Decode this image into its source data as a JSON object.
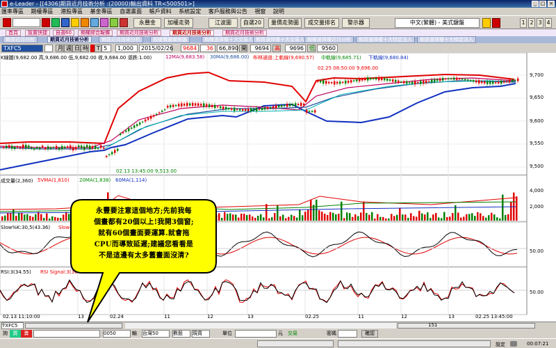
{
  "window": {
    "title": "e-Leader - [[4306]期貨近月技術分析 :(20000)輸出資料  TR<500501>]",
    "controls": [
      "_",
      "□",
      "×"
    ]
  },
  "menu": [
    "匯率專區",
    "期權專區",
    "港股專區",
    "基金專區",
    "自選畫面",
    "帳戶資料",
    "系統設定",
    "客戶服務與公告",
    "視窗",
    "說明"
  ],
  "toolbar": {
    "buttons": [
      "永豐金",
      "加權走勢",
      "江波圖",
      "自選20",
      "量價走勢圖",
      "成交量排名",
      "警示器"
    ],
    "language": "中文(繁體) - 美式鍵盤",
    "page_numbers": [
      "1",
      "2",
      "3",
      "4"
    ]
  },
  "tabs_top": [
    "首頁",
    "設置快捷",
    "自選60",
    "期權綜合報價",
    "期貨近月技術分析",
    "期貨近月技術分析",
    "期貨近月技術分析"
  ],
  "tabs_second": [
    "期貨近月分析",
    "期貨近月技術分析",
    "期貨近月技術分析",
    "期權價量關係圖",
    "期權選擇權十大交易人",
    "期貨選擇權十大交易人",
    "期權選擇權近月分析",
    "期貨選擇權十大特定法人",
    "期貨選擇權十大特定法人"
  ],
  "controls": {
    "symbol": "TXFC5",
    "period_label": "月",
    "period_buttons": [
      "週",
      "日",
      "時"
    ],
    "t_label": "T",
    "t_value": "5",
    "count": "1,000",
    "date": "2015/02/26",
    "quote_last": "9684",
    "quote_change": "36",
    "quote_volume": "66,890",
    "open_label": "開",
    "open_value": "9694",
    "high_label": "高",
    "high_value": "9696",
    "low_label": "低",
    "low_value": "9560"
  },
  "panels": {
    "kline": {
      "header": "K線圖(9,682.00 高,9,686.00 低,9,682.00 收,9,684.00 漲跌:1.00)",
      "ma12": "12MA(9,683.58)",
      "ma30": "30MA(9,686.00)",
      "bband": "布林通道:上軌線(9,690.57)",
      "mid_band": "中軌線(9,685.71)",
      "low_band": "下軌線(9,680.84)",
      "annotation_high": "02.25 08:50:00  9,696.00",
      "annotation_low": "02.13 13:45:00  9,513.00",
      "y_ticks": [
        "9,700",
        "9,650",
        "9,600",
        "9,550",
        "9,500"
      ]
    },
    "volume": {
      "header": "成交量(2,360)",
      "ma5": "5VMA(1,810)",
      "ma20": "20MA(1,838)",
      "ma60": "60MA(1,114)",
      "y_ticks": [
        "4,000",
        "2,000"
      ]
    },
    "kd": {
      "header": "Slow%K:30,5(43.36)",
      "d_label": "Slow",
      "y_ticks": [
        "50.00"
      ]
    },
    "rsi": {
      "header": "RSI:3(34.55)",
      "signal": "RSI Signal:3(36",
      "y_ticks": [
        "50.00"
      ]
    }
  },
  "time_axis": {
    "labels": [
      "02.13 11:10:00",
      "13",
      "02.24",
      "11",
      "12",
      "13",
      "02.25",
      "11",
      "12",
      "13",
      "02.25 13:45:00"
    ]
  },
  "status": {
    "symbol_tab": "TXFC5",
    "scroll_value": "151"
  },
  "order_bar": {
    "buy_label": "買",
    "sell_label": "賣",
    "code": "0050",
    "exchange_label": "輸",
    "market": "台灣50",
    "quantity_label": "數股",
    "price_type": "現貨",
    "unit_label": "單位",
    "price_unit": "元",
    "order_type": "交易",
    "password_label": "密碼",
    "confirm_label": "確認",
    "settings_label": "設定",
    "clock": "00:07:21"
  },
  "callout": {
    "lines": [
      "永豐要注意這個地方;先前我每",
      "個畫都有20個以上!我開3個窗;",
      "就有60個畫面要運算.就會拖",
      "CPU而導致延遲;建議您看看是",
      "不是這邊有太多舊畫面沒清?"
    ]
  },
  "colors": {
    "up": "#e00000",
    "down": "#008000",
    "bb_upper": "#e00000",
    "bb_lower": "#1030c0",
    "ma12": "#c00060",
    "ma30": "#2050a0",
    "callout_fill": "#ffff00"
  }
}
